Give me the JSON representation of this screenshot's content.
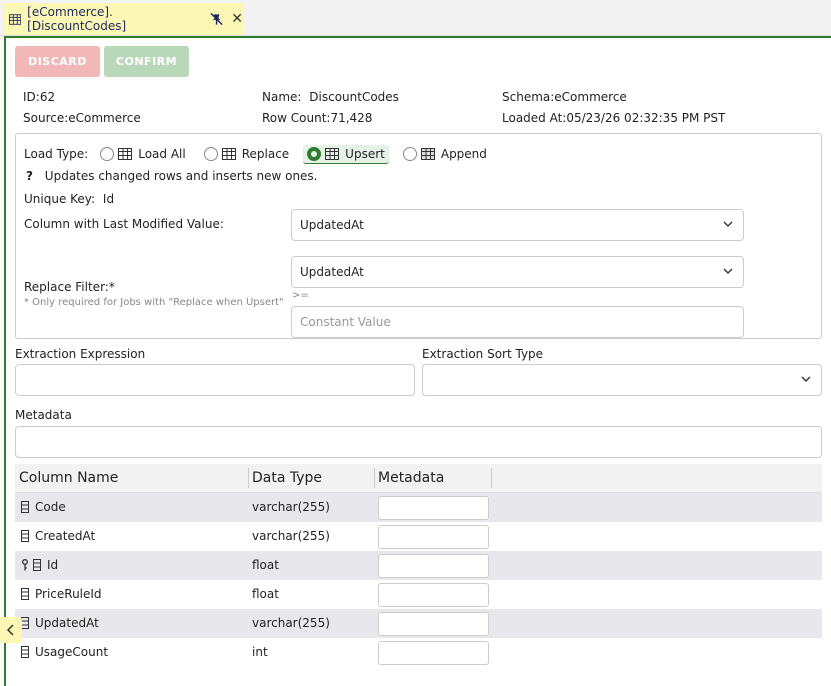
{
  "tab": {
    "title": "[eCommerce].[DiscountCodes]",
    "close": "✕"
  },
  "toolbar": {
    "discard_label": "DISCARD",
    "confirm_label": "CONFIRM"
  },
  "info": {
    "id": "ID:62",
    "name_label": "Name:",
    "name_value": "DiscountCodes",
    "schema": "Schema:eCommerce",
    "source": "Source:eCommerce",
    "row_count": "Row Count:71,428",
    "loaded_at": "Loaded At:05/23/26 02:32:35 PM PST"
  },
  "load_type": {
    "label": "Load Type:",
    "options": [
      {
        "label": "Load All",
        "selected": false
      },
      {
        "label": "Replace",
        "selected": false
      },
      {
        "label": "Upsert",
        "selected": true
      },
      {
        "label": "Append",
        "selected": false
      }
    ],
    "description": "Updates changed rows and inserts new ones.",
    "help_glyph": "?",
    "unique_key_label": "Unique Key:",
    "unique_key_value": "Id",
    "last_modified_label": "Column with Last Modified Value:",
    "last_modified_value": "UpdatedAt",
    "replace_filter_label": "Replace Filter:*",
    "replace_filter_note": "* Only required for Jobs with \"Replace when Upsert\"",
    "replace_filter_column": "UpdatedAt",
    "operator": ">=",
    "constant_placeholder": "Constant Value"
  },
  "extraction": {
    "expression_label": "Extraction Expression",
    "sort_type_label": "Extraction Sort Type",
    "metadata_label": "Metadata"
  },
  "table": {
    "headers": [
      "Column Name",
      "Data Type",
      "Metadata"
    ],
    "rows": [
      {
        "name": "Code",
        "type": "varchar(255)",
        "key": false
      },
      {
        "name": "CreatedAt",
        "type": "varchar(255)",
        "key": false
      },
      {
        "name": "Id",
        "type": "float",
        "key": true
      },
      {
        "name": "PriceRuleId",
        "type": "float",
        "key": false
      },
      {
        "name": "UpdatedAt",
        "type": "varchar(255)",
        "key": false
      },
      {
        "name": "UsageCount",
        "type": "int",
        "key": false
      }
    ]
  },
  "colors": {
    "accent": "#2e7d32",
    "tab_bg": "#fdf7b6",
    "discard": "#f2b8b8",
    "confirm": "#b9d8b9"
  }
}
